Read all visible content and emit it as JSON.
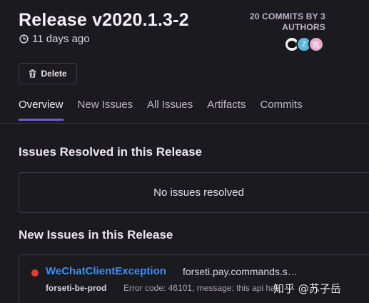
{
  "release": {
    "title": "Release v2020.1.3-2",
    "age": "11 days ago",
    "commits_summary": "20 COMMITS BY 3 AUTHORS",
    "authors": [
      {
        "initial": ""
      },
      {
        "initial": "Z"
      },
      {
        "initial": "陈"
      }
    ]
  },
  "actions": {
    "delete_label": "Delete"
  },
  "tabs": [
    {
      "label": "Overview",
      "active": true
    },
    {
      "label": "New Issues",
      "active": false
    },
    {
      "label": "All Issues",
      "active": false
    },
    {
      "label": "Artifacts",
      "active": false
    },
    {
      "label": "Commits",
      "active": false
    }
  ],
  "resolved": {
    "title": "Issues Resolved in this Release",
    "empty_text": "No issues resolved"
  },
  "new_issues": {
    "title": "New Issues in this Release",
    "items": [
      {
        "type": "WeChatClientException",
        "culprit": "forseti.pay.commands.s…",
        "project": "forseti-be-prod",
        "message": "Error code: 46101, message: this api has"
      }
    ]
  },
  "watermark": "知乎 @苏子岳",
  "colors": {
    "accent": "#6c5fc7",
    "link": "#3d8ef1",
    "error": "#e03e2f",
    "background": "#1b1a1f"
  },
  "icons": {
    "age": "clock-icon",
    "delete": "trash-icon"
  }
}
